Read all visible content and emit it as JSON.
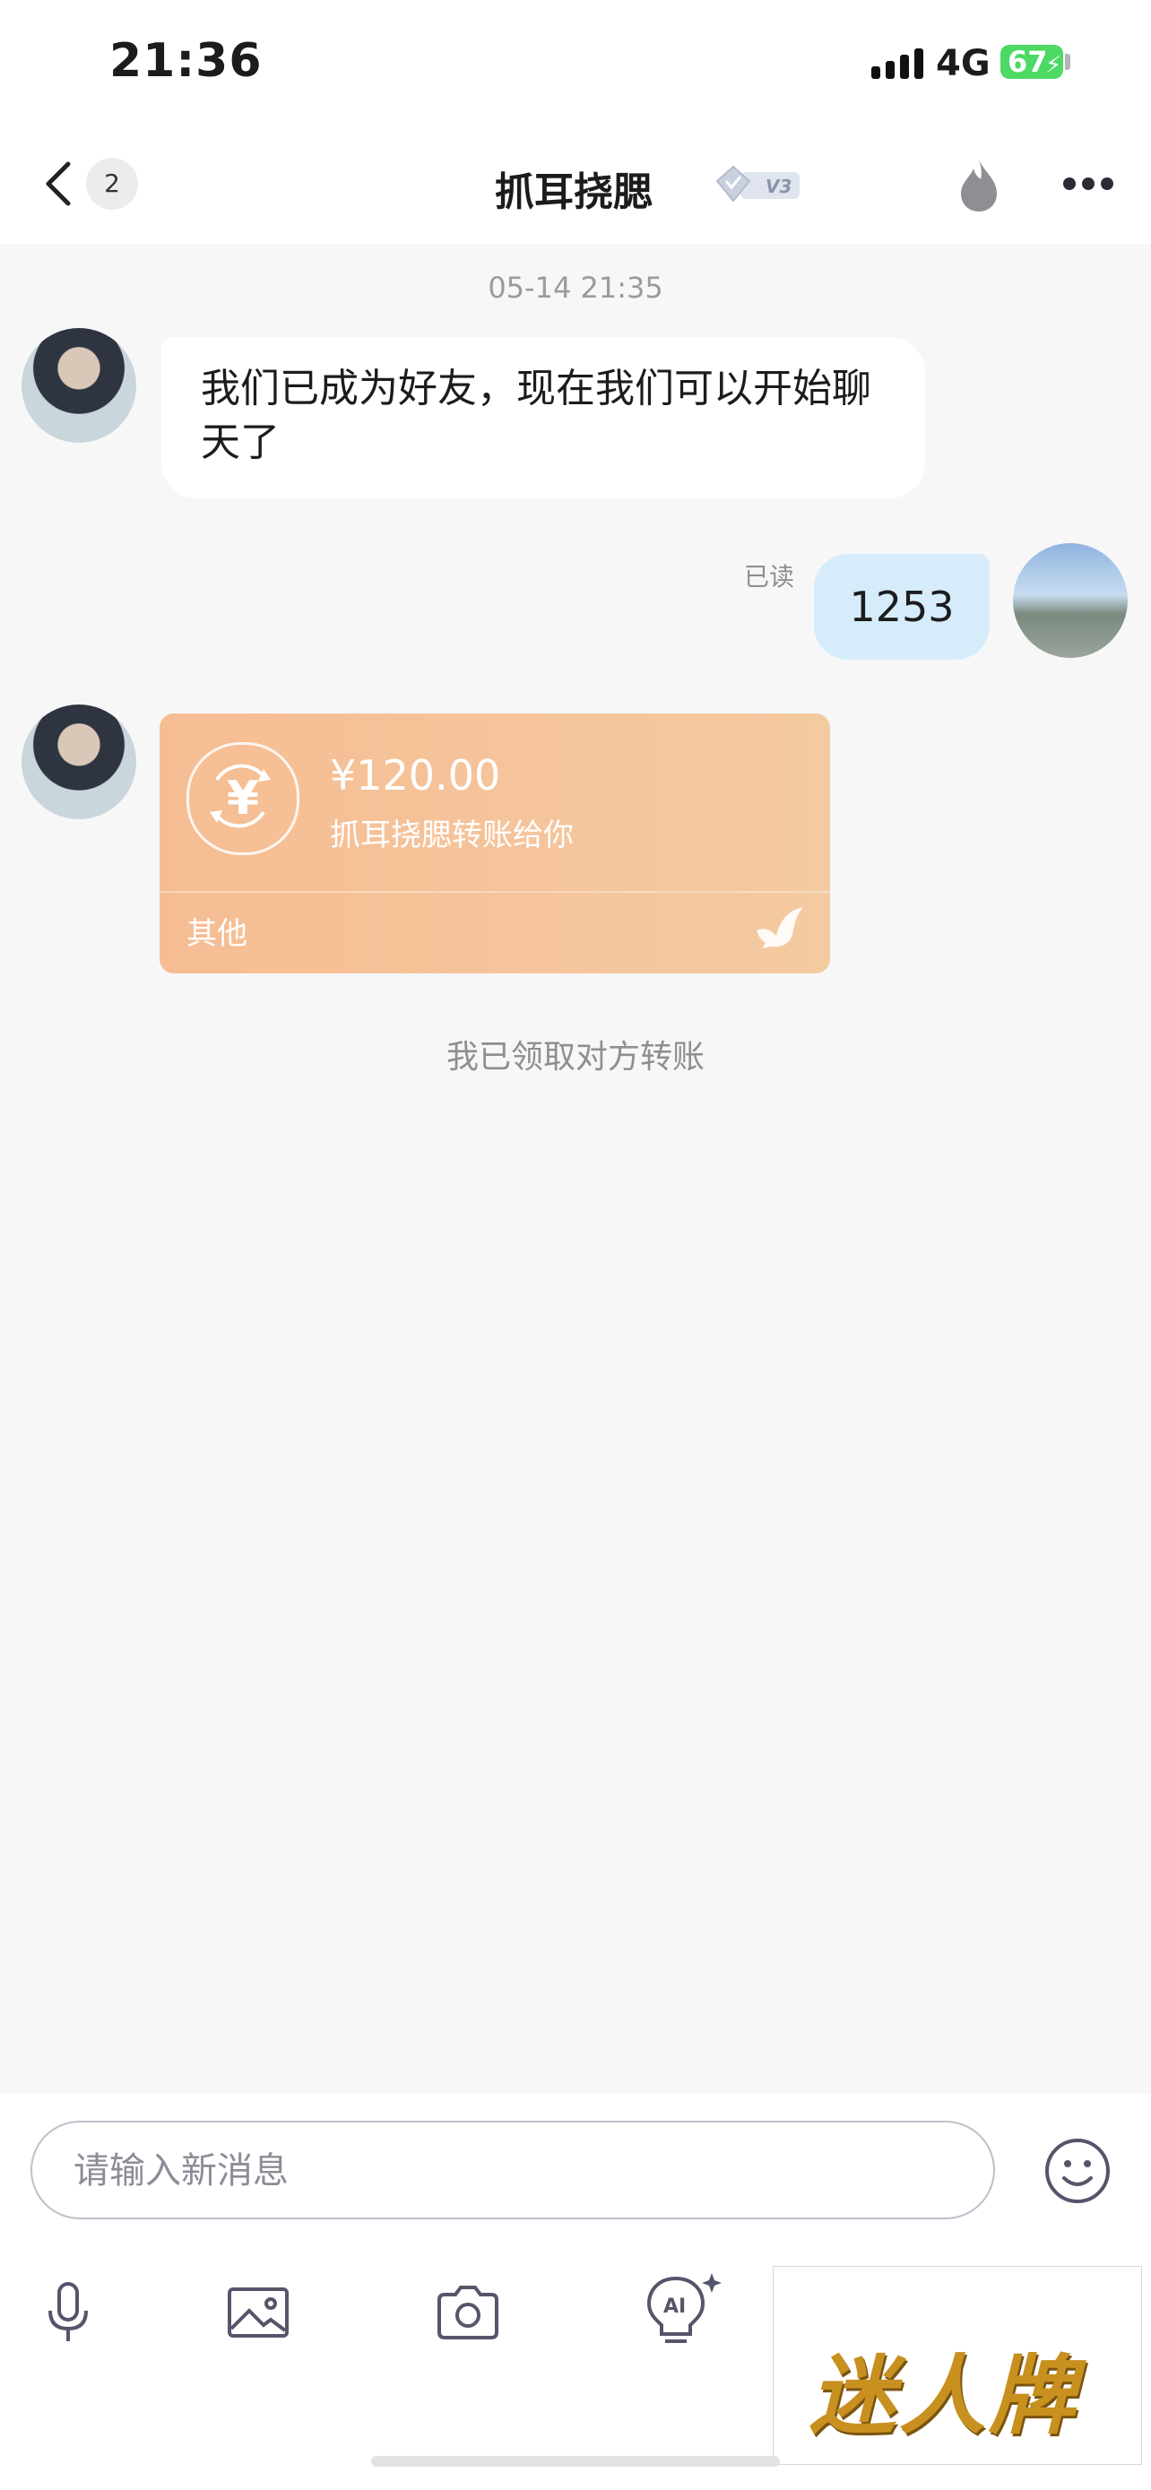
{
  "status_bar": {
    "time": "21:36",
    "network": "4G",
    "battery": "67"
  },
  "header": {
    "unread_count": "2",
    "title": "抓耳挠腮",
    "level_badge": "V3"
  },
  "chat": {
    "timestamp": "05-14 21:35",
    "messages": [
      {
        "from": "contact",
        "text": "我们已成为好友，现在我们可以开始聊天了"
      },
      {
        "from": "me",
        "text": "1253",
        "status": "已读"
      }
    ],
    "transfer": {
      "amount": "¥120.00",
      "description": "抓耳挠腮转账给你",
      "type": "其他"
    },
    "system_note": "我已领取对方转账"
  },
  "composer": {
    "placeholder": "请输入新消息",
    "value": ""
  },
  "toolbar": {
    "icons": [
      "microphone-icon",
      "image-icon",
      "camera-icon",
      "ai-bulb-icon"
    ]
  },
  "watermark": {
    "text": "迷人牌"
  },
  "colors": {
    "outgoing_bubble": "#d6ecfb",
    "transfer_card": "#f6bd93",
    "battery": "#4cd964"
  }
}
